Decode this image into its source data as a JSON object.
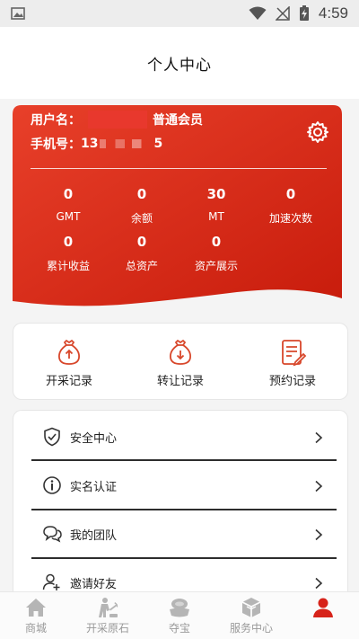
{
  "status_bar": {
    "time": "4:59"
  },
  "header": {
    "title": "个人中心"
  },
  "profile": {
    "username_label": "用户名：",
    "member_level": "普通会员",
    "phone_label": "手机号：",
    "phone_prefix": "13",
    "phone_suffix": "5",
    "stats": [
      {
        "value": "0",
        "label": "GMT"
      },
      {
        "value": "0",
        "label": "余额"
      },
      {
        "value": "30",
        "label": "MT"
      },
      {
        "value": "0",
        "label": "加速次数"
      },
      {
        "value": "0",
        "label": "累计收益"
      },
      {
        "value": "0",
        "label": "总资产"
      },
      {
        "value": "0",
        "label": "资产展示"
      }
    ]
  },
  "records": [
    {
      "label": "开采记录",
      "icon": "bag-up-icon"
    },
    {
      "label": "转让记录",
      "icon": "bag-down-icon"
    },
    {
      "label": "预约记录",
      "icon": "document-edit-icon"
    }
  ],
  "menu": [
    {
      "label": "安全中心",
      "icon": "shield-check-icon"
    },
    {
      "label": "实名认证",
      "icon": "info-icon"
    },
    {
      "label": "我的团队",
      "icon": "chat-bubbles-icon"
    },
    {
      "label": "邀请好友",
      "icon": "add-user-icon"
    }
  ],
  "bottom_nav": [
    {
      "label": "商城",
      "icon": "home-icon",
      "active": false
    },
    {
      "label": "开采原石",
      "icon": "miner-icon",
      "active": false
    },
    {
      "label": "夺宝",
      "icon": "treasure-icon",
      "active": false
    },
    {
      "label": "服务中心",
      "icon": "cube-icon",
      "active": false
    },
    {
      "label": "",
      "icon": "user-icon",
      "active": true
    }
  ],
  "colors": {
    "card_red": "#e3341f",
    "card_red_dark": "#c41e0e",
    "accent": "#e0392a",
    "nav_inactive": "#b0b0b0"
  }
}
